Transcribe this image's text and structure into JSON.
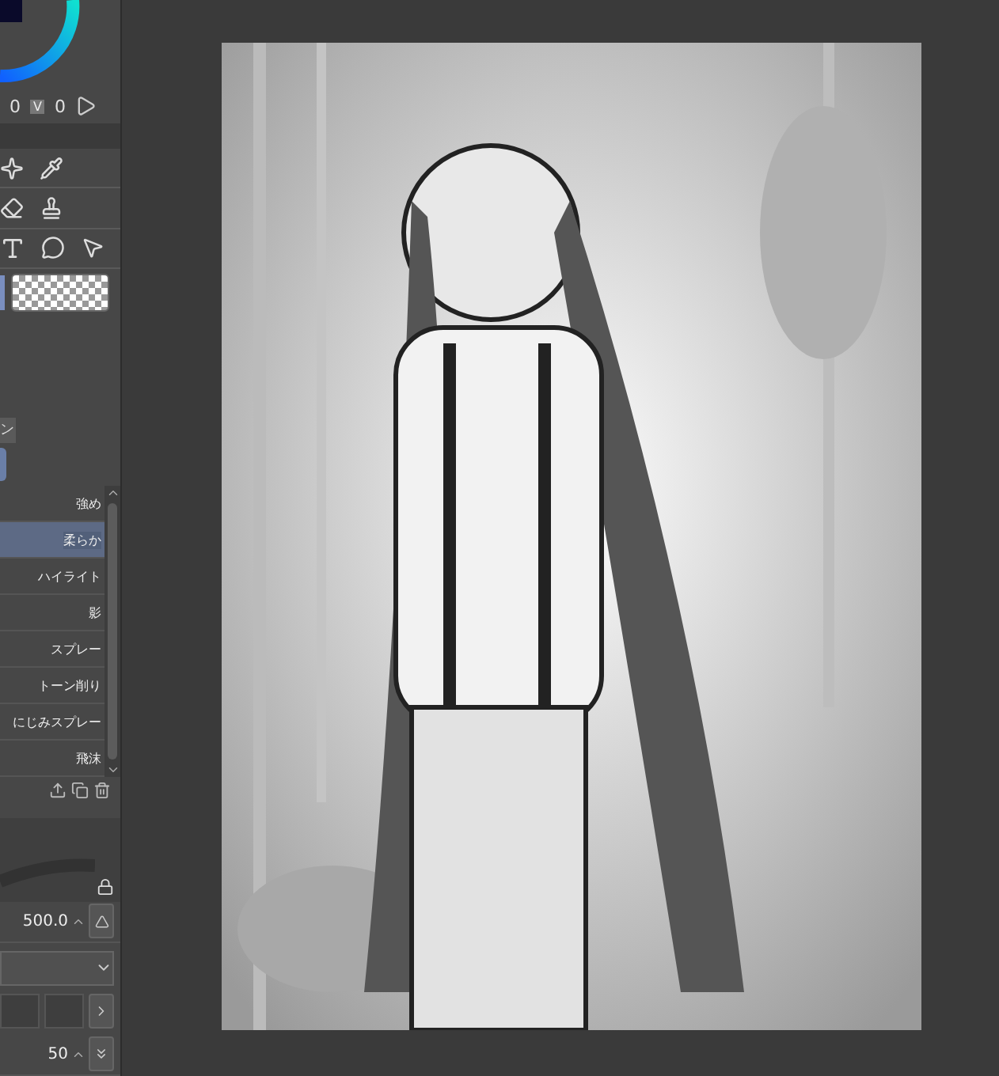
{
  "color_panel": {
    "values": [
      {
        "text": "0"
      },
      {
        "text": "V",
        "kind": "badge"
      },
      {
        "text": "0"
      }
    ]
  },
  "subtool_tab": {
    "label": "ン"
  },
  "subtools": [
    {
      "label": "強め",
      "selected": false
    },
    {
      "label": "柔らか",
      "selected": true
    },
    {
      "label": "ハイライト",
      "selected": false
    },
    {
      "label": "影",
      "selected": false
    },
    {
      "label": "スプレー",
      "selected": false
    },
    {
      "label": "トーン削り",
      "selected": false
    },
    {
      "label": "にじみスプレー",
      "selected": false
    },
    {
      "label": "飛沫",
      "selected": false
    }
  ],
  "brush_size": {
    "value": "500.0"
  },
  "density": {
    "value": "50"
  }
}
